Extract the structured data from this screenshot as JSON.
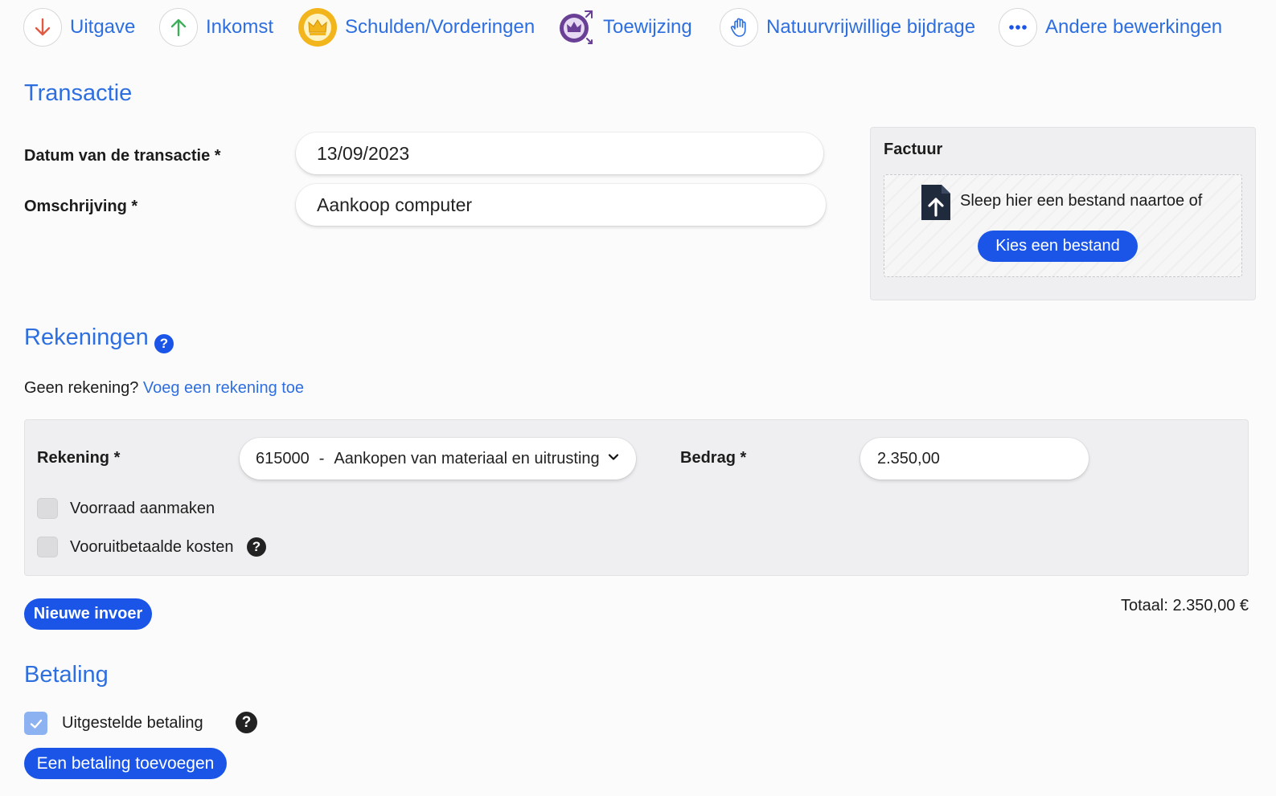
{
  "toolbar": {
    "items": [
      {
        "label": "Uitgave",
        "icon": "arrow-down-icon"
      },
      {
        "label": "Inkomst",
        "icon": "arrow-up-icon"
      },
      {
        "label": "Schulden/Vorderingen",
        "icon": "crown-icon"
      },
      {
        "label": "Toewijzing",
        "icon": "crown-transfer-icon"
      },
      {
        "label": "Natuurvrijwillige bijdrage",
        "icon": "hand-icon"
      },
      {
        "label": "Andere bewerkingen",
        "icon": "more-dots-icon"
      }
    ]
  },
  "transactie": {
    "title": "Transactie",
    "date_label": "Datum van de transactie *",
    "date_value": "13/09/2023",
    "desc_label": "Omschrijving *",
    "desc_value": "Aankoop computer"
  },
  "factuur": {
    "title": "Factuur",
    "drop_text": "Sleep hier een bestand naartoe of",
    "choose_button": "Kies een bestand"
  },
  "rekeningen": {
    "title": "Rekeningen",
    "no_account_text": "Geen rekening?",
    "add_account_link": "Voeg een rekening toe",
    "account_label": "Rekening *",
    "account_code": "615000",
    "account_separator": "-",
    "account_name": "Aankopen van materiaal en uitrusting",
    "amount_label": "Bedrag *",
    "amount_value": "2.350,00",
    "checkbox_stock": "Voorraad aanmaken",
    "checkbox_prepaid": "Vooruitbetaalde kosten",
    "new_entry_button": "Nieuwe invoer",
    "total": "Totaal: 2.350,00 €"
  },
  "betaling": {
    "title": "Betaling",
    "deferred_label": "Uitgestelde betaling",
    "deferred_checked": true,
    "add_payment_button": "Een betaling toevoegen"
  },
  "colors": {
    "accent": "#1a55e8",
    "link": "#2e6fe0",
    "expense_red": "#e05a44",
    "income_green": "#3fae5a",
    "debt_gold": "#f3b51c",
    "allocation_purple": "#6a3f96"
  }
}
